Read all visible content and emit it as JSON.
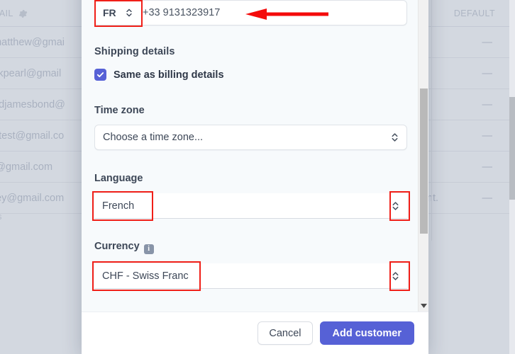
{
  "background": {
    "column_headers": {
      "email": "MAIL",
      "default": "DEFAULT"
    },
    "settings_icon": "gear-icon",
    "rows": [
      {
        "email": "amatthew@gmai",
        "note": "",
        "default": "—"
      },
      {
        "email": "ackpearl@gmail",
        "note": "",
        "default": "—"
      },
      {
        "email": "ondjamesbond@",
        "note": "",
        "default": "—"
      },
      {
        "email": "netest@gmail.co",
        "note": "",
        "default": "—"
      },
      {
        "email": "st@gmail.com",
        "note": "",
        "default": "—"
      },
      {
        "email": "krey@gmail.com",
        "note": "ave int.",
        "default": "—"
      }
    ],
    "footer_text": "s"
  },
  "modal": {
    "phone": {
      "country_code": "FR",
      "value": "+33  9131323917",
      "chevron_icon": "chevron-updown-icon"
    },
    "shipping": {
      "section_label": "Shipping details",
      "same_as_billing_label": "Same as billing details",
      "same_as_billing_checked": true
    },
    "timezone": {
      "label": "Time zone",
      "value": "Choose a time zone...",
      "chevron_icon": "chevron-updown-icon"
    },
    "language": {
      "label": "Language",
      "value": "French",
      "chevron_icon": "chevron-updown-icon"
    },
    "currency": {
      "label": "Currency",
      "info_icon": "info-icon",
      "info_glyph": "i",
      "value": "CHF - Swiss Franc",
      "chevron_icon": "chevron-updown-icon"
    },
    "footer": {
      "cancel_label": "Cancel",
      "submit_label": "Add customer"
    }
  },
  "annotations": {
    "highlight_color": "#f01f18",
    "arrow_color": "#f40b0b",
    "arrow_direction": "left"
  },
  "colors": {
    "accent": "#5661d6",
    "backdrop": "#d3d8e0",
    "modal_body": "#f7fafc",
    "text": "#3d4757"
  }
}
